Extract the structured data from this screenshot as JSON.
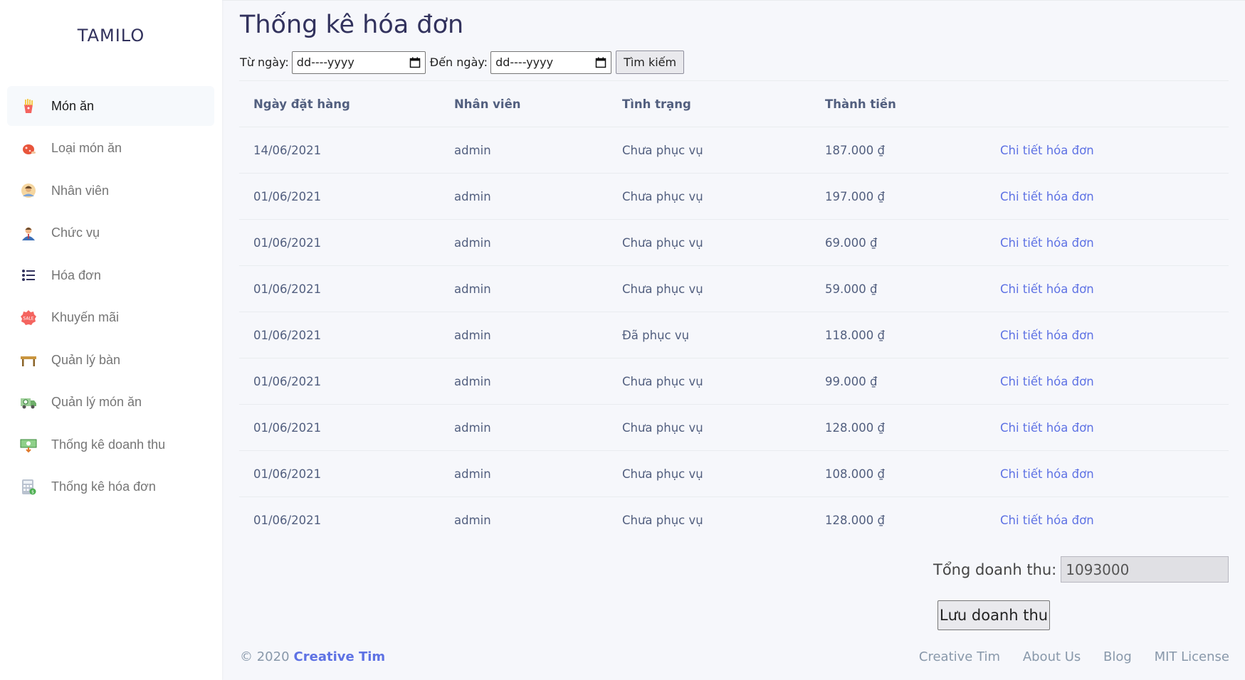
{
  "sidebar": {
    "brand": "TAMILO",
    "items": [
      {
        "label": "Món ăn",
        "icon": "fries-icon"
      },
      {
        "label": "Loại món ăn",
        "icon": "meat-icon"
      },
      {
        "label": "Nhân viên",
        "icon": "staff-icon"
      },
      {
        "label": "Chức vụ",
        "icon": "user-role-icon"
      },
      {
        "label": "Hóa đơn",
        "icon": "list-icon"
      },
      {
        "label": "Khuyến mãi",
        "icon": "sale-icon"
      },
      {
        "label": "Quản lý bàn",
        "icon": "table-icon"
      },
      {
        "label": "Quản lý món ăn",
        "icon": "delivery-icon"
      },
      {
        "label": "Thống kê doanh thu",
        "icon": "money-icon"
      },
      {
        "label": "Thống kê hóa đơn",
        "icon": "calculator-icon"
      }
    ]
  },
  "page": {
    "title": "Thống kê hóa đơn"
  },
  "filter": {
    "from_label": "Từ ngày:",
    "from_placeholder": "dd----yyyy",
    "to_label": "Đến ngày:",
    "to_placeholder": "dd----yyyy",
    "search_label": "Tìm kiếm"
  },
  "table": {
    "headers": [
      "Ngày đặt hàng",
      "Nhân viên",
      "Tình trạng",
      "Thành tiền",
      ""
    ],
    "link_label": "Chi tiết hóa đơn",
    "rows": [
      [
        "14/06/2021",
        "admin",
        "Chưa phục vụ",
        "187.000 ₫"
      ],
      [
        "01/06/2021",
        "admin",
        "Chưa phục vụ",
        "197.000 ₫"
      ],
      [
        "01/06/2021",
        "admin",
        "Chưa phục vụ",
        "69.000 ₫"
      ],
      [
        "01/06/2021",
        "admin",
        "Chưa phục vụ",
        "59.000 ₫"
      ],
      [
        "01/06/2021",
        "admin",
        "Đã phục vụ",
        "118.000 ₫"
      ],
      [
        "01/06/2021",
        "admin",
        "Chưa phục vụ",
        "99.000 ₫"
      ],
      [
        "01/06/2021",
        "admin",
        "Chưa phục vụ",
        "128.000 ₫"
      ],
      [
        "01/06/2021",
        "admin",
        "Chưa phục vụ",
        "108.000 ₫"
      ],
      [
        "01/06/2021",
        "admin",
        "Chưa phục vụ",
        "128.000 ₫"
      ]
    ]
  },
  "summary": {
    "total_label": "Tổng doanh thu:",
    "total_value": "1093000",
    "save_label": "Lưu doanh thu"
  },
  "footer": {
    "copyright": "© 2020",
    "brand": "Creative Tim",
    "links": [
      "Creative Tim",
      "About Us",
      "Blog",
      "MIT License"
    ]
  },
  "colors": {
    "accent": "#5e72e4",
    "title": "#32325d",
    "text": "#525f7f"
  }
}
